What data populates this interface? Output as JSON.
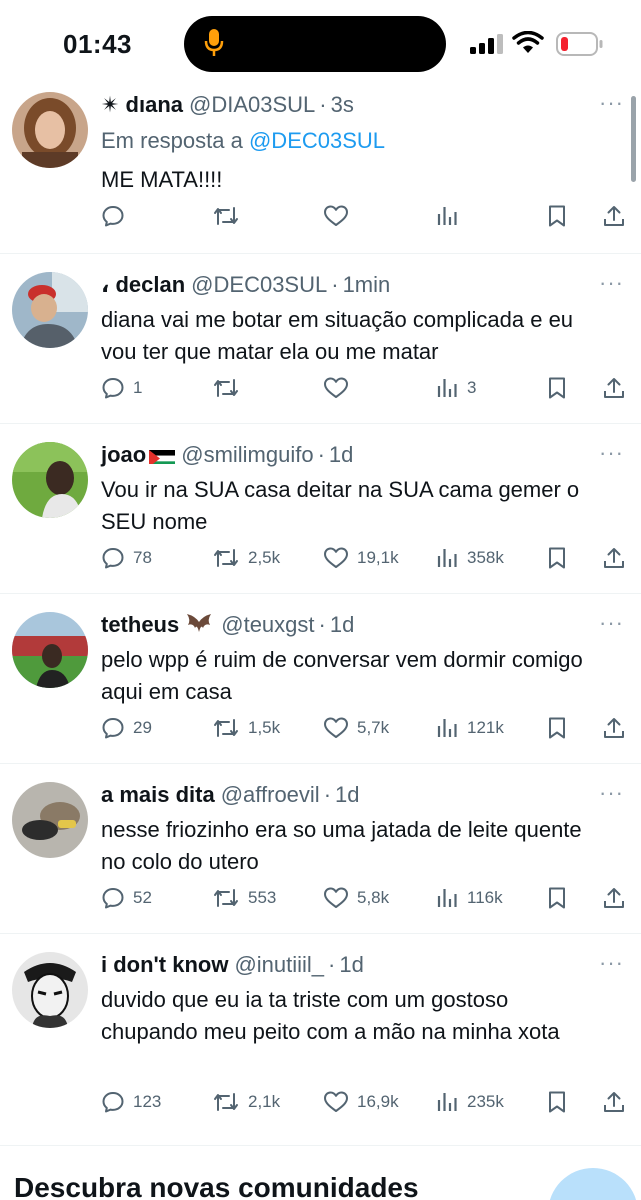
{
  "status_bar": {
    "time": "01:43"
  },
  "tweets": [
    {
      "name": "✴ dıana",
      "handle": "@DIA03SUL",
      "time": "3s",
      "reply_prefix": "Em resposta a",
      "reply_to": "@DEC03SUL",
      "text": "ME MATA!!!!",
      "replies": "",
      "retweets": "",
      "likes": "",
      "views": ""
    },
    {
      "name": "، declan",
      "handle": "@DEC03SUL",
      "time": "1min",
      "text": "diana vai me botar em situação complicada e eu vou ter que matar ela ou me matar",
      "replies": "1",
      "retweets": "",
      "likes": "",
      "views": "3"
    },
    {
      "name": "joao",
      "handle": "@smilimguifo",
      "time": "1d",
      "text": "Vou ir na SUA casa deitar na SUA cama gemer o SEU nome",
      "replies": "78",
      "retweets": "2,5k",
      "likes": "19,1k",
      "views": "358k"
    },
    {
      "name": "tetheus",
      "handle": "@teuxgst",
      "time": "1d",
      "text": "pelo wpp é ruim de conversar vem dormir comigo aqui em casa",
      "replies": "29",
      "retweets": "1,5k",
      "likes": "5,7k",
      "views": "121k"
    },
    {
      "name": "a mais dita",
      "handle": "@affroevil",
      "time": "1d",
      "text": "nesse friozinho era so uma jatada de leite quente no colo do utero",
      "replies": "52",
      "retweets": "553",
      "likes": "5,8k",
      "views": "116k"
    },
    {
      "name": "i don't know",
      "handle": "@inutiiil_",
      "time": "1d",
      "text": "duvido que eu ia ta triste com um gostoso chupando meu peito com a mão na minha xota",
      "replies": "123",
      "retweets": "2,1k",
      "likes": "16,9k",
      "views": "235k"
    }
  ],
  "section": {
    "title": "Descubra novas comunidades"
  },
  "icons": [
    "mic-icon",
    "signal-icon",
    "wifi-icon",
    "battery-icon",
    "more-icon",
    "reply-icon",
    "retweet-icon",
    "like-icon",
    "views-icon",
    "bookmark-icon",
    "share-icon"
  ],
  "colors": {
    "accent": "#1d9bf0",
    "secondary_text": "#536471",
    "battery_low": "#f4212e",
    "mic": "#ff9f0a"
  }
}
